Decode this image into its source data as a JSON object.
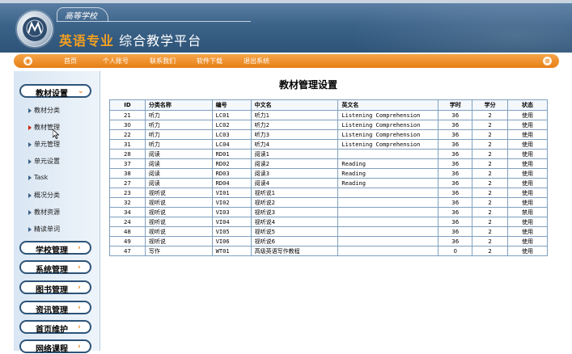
{
  "header": {
    "school": "高等学校",
    "title_highlight": "英语专业",
    "title_rest": " 综合教学平台",
    "logo_icon": "university-seal-icon"
  },
  "nav": {
    "items": [
      "首页",
      "个人账号",
      "联系我们",
      "软件下载",
      "退出系统"
    ]
  },
  "sidebar": {
    "sections": [
      {
        "label": "教材设置",
        "expanded": true
      },
      {
        "label": "学校管理"
      },
      {
        "label": "系统管理"
      },
      {
        "label": "图书管理"
      },
      {
        "label": "资讯管理"
      },
      {
        "label": "首页维护"
      },
      {
        "label": "网络课程"
      }
    ],
    "items": [
      "教材分类",
      "教材管理",
      "单元管理",
      "单元设置",
      "Task",
      "概况分类",
      "教材资源",
      "精读单词"
    ]
  },
  "main": {
    "title": "教材管理设置",
    "columns": [
      "ID",
      "分类名称",
      "编号",
      "中文名",
      "英文名",
      "学时",
      "学分",
      "状态"
    ],
    "rows": [
      [
        "21",
        "听力",
        "LC01",
        "听力1",
        "Listening Comprehension",
        "36",
        "2",
        "使用"
      ],
      [
        "30",
        "听力",
        "LC02",
        "听力2",
        "Listening Comprehension",
        "36",
        "2",
        "使用"
      ],
      [
        "22",
        "听力",
        "LC03",
        "听力3",
        "Listening Comprehension",
        "36",
        "2",
        "使用"
      ],
      [
        "31",
        "听力",
        "LC04",
        "听力4",
        "Listening Comprehension",
        "36",
        "2",
        "使用"
      ],
      [
        "28",
        "阅读",
        "RD01",
        "阅读1",
        "",
        "36",
        "2",
        "使用"
      ],
      [
        "37",
        "阅读",
        "RD02",
        "阅读2",
        "Reading",
        "36",
        "2",
        "使用"
      ],
      [
        "38",
        "阅读",
        "RD03",
        "阅读3",
        "Reading",
        "36",
        "2",
        "使用"
      ],
      [
        "27",
        "阅读",
        "RD04",
        "阅读4",
        "Reading",
        "36",
        "2",
        "使用"
      ],
      [
        "23",
        "视听说",
        "VI01",
        "视听说1",
        "",
        "36",
        "2",
        "使用"
      ],
      [
        "32",
        "视听说",
        "VI02",
        "视听说2",
        "",
        "36",
        "2",
        "使用"
      ],
      [
        "34",
        "视听说",
        "VI03",
        "视听说3",
        "",
        "36",
        "2",
        "禁用"
      ],
      [
        "24",
        "视听说",
        "VI04",
        "视听说4",
        "",
        "36",
        "2",
        "使用"
      ],
      [
        "48",
        "视听说",
        "VI05",
        "视听说5",
        "",
        "36",
        "2",
        "使用"
      ],
      [
        "49",
        "视听说",
        "VI06",
        "视听说6",
        "",
        "36",
        "2",
        "使用"
      ],
      [
        "47",
        "写作",
        "WT01",
        "高级英语写作教程",
        "",
        "0",
        "2",
        "使用"
      ]
    ]
  },
  "colors": {
    "header_blue": "#3b6288",
    "nav_orange": "#e67f15",
    "title_orange": "#f3a021",
    "table_border": "#7fa0c0"
  }
}
